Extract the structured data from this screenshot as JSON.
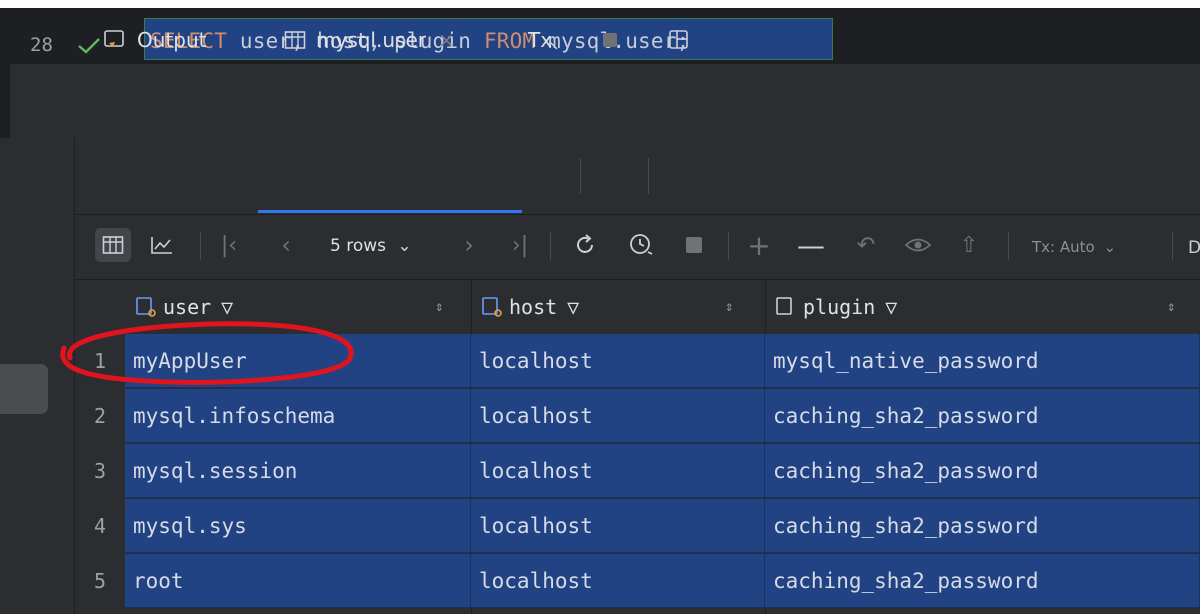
{
  "editor": {
    "line_number": "28",
    "code": {
      "kw_select": "SELECT",
      "col1": "user",
      "col2": "host",
      "col3": "plugin",
      "kw_from": "FROM",
      "table": "mysql.user",
      "end": ";"
    }
  },
  "tabs": [
    {
      "label": "Output",
      "icon": "output-console-icon"
    },
    {
      "label": "mysql.user",
      "icon": "table-grid-icon",
      "active": true,
      "closable": true
    },
    {
      "label": "Tx",
      "icon": "transaction-icon"
    },
    {
      "label": "",
      "icon": "stop-square-icon"
    },
    {
      "label": "",
      "icon": "layout-split-icon"
    }
  ],
  "toolbar": {
    "rows_label": "5 rows",
    "tx_mode": "Tx: Auto"
  },
  "grid": {
    "columns": [
      {
        "label": "user"
      },
      {
        "label": "host"
      },
      {
        "label": "plugin"
      }
    ],
    "rows": [
      {
        "num": "1",
        "user": "myAppUser",
        "host": "localhost",
        "plugin": "mysql_native_password"
      },
      {
        "num": "2",
        "user": "mysql.infoschema",
        "host": "localhost",
        "plugin": "caching_sha2_password"
      },
      {
        "num": "3",
        "user": "mysql.session",
        "host": "localhost",
        "plugin": "caching_sha2_password"
      },
      {
        "num": "4",
        "user": "mysql.sys",
        "host": "localhost",
        "plugin": "caching_sha2_password"
      },
      {
        "num": "5",
        "user": "root",
        "host": "localhost",
        "plugin": "caching_sha2_password"
      }
    ]
  },
  "colors": {
    "selection": "#214283",
    "accent": "#3574f0",
    "annotation": "#e0141e",
    "success": "#5fb865"
  }
}
